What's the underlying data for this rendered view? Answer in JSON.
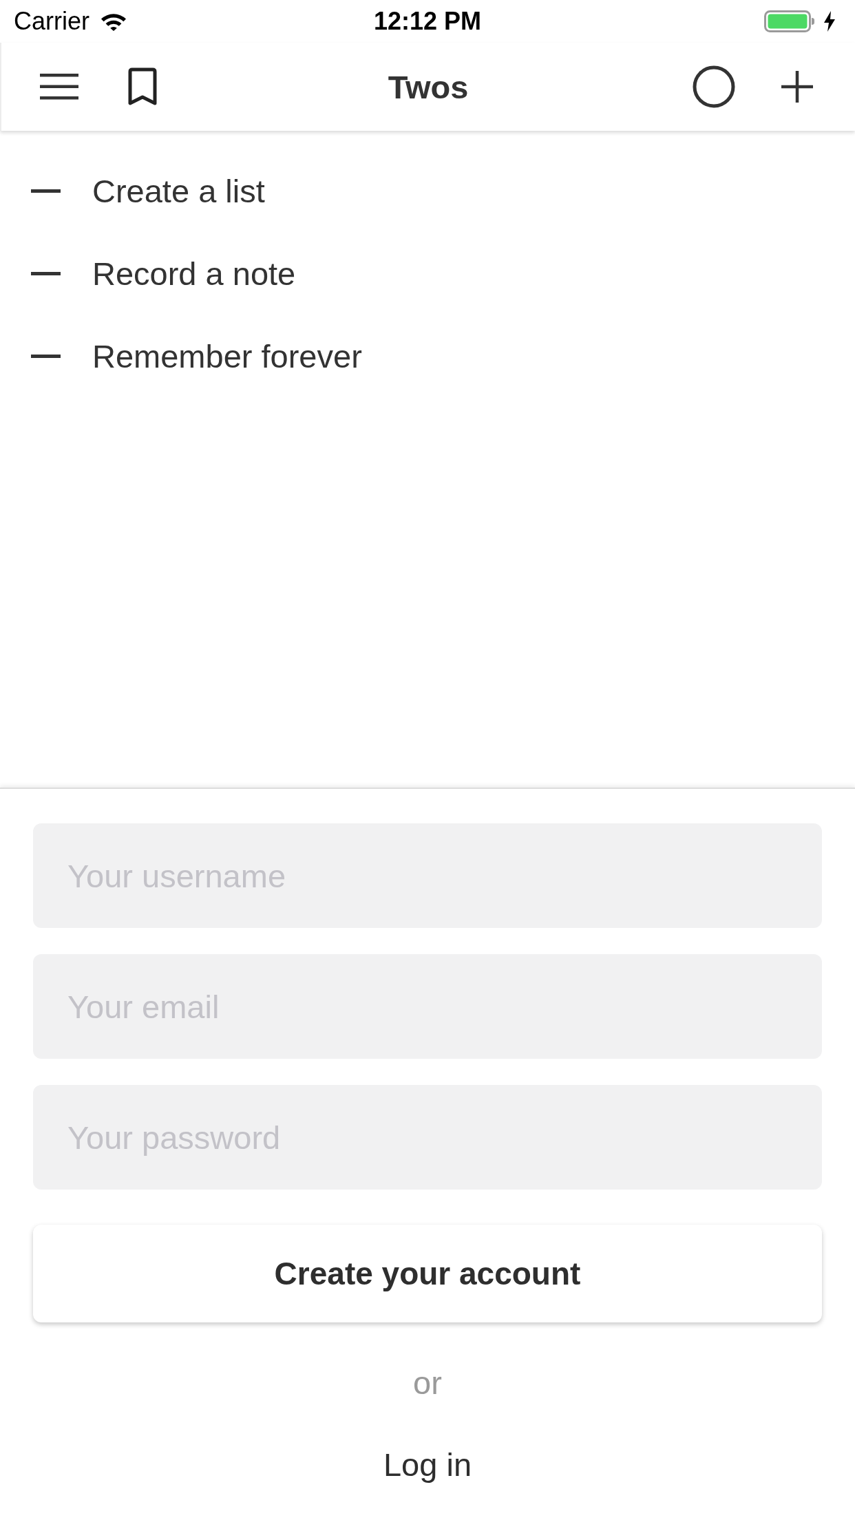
{
  "status_bar": {
    "carrier": "Carrier",
    "time": "12:12 PM",
    "charging": true
  },
  "header": {
    "title": "Twos"
  },
  "list": {
    "items": [
      {
        "text": "Create a list"
      },
      {
        "text": "Record a note"
      },
      {
        "text": "Remember forever"
      }
    ]
  },
  "signup": {
    "fields": [
      {
        "placeholder": "Your username"
      },
      {
        "placeholder": "Your email"
      },
      {
        "placeholder": "Your password"
      }
    ],
    "button": "Create your account",
    "separator": "or",
    "login_link": "Log in"
  }
}
